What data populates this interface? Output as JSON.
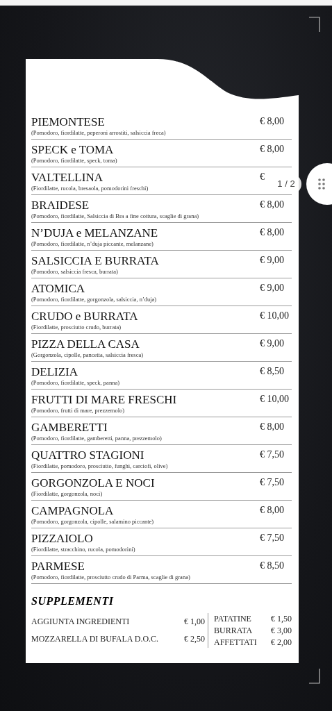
{
  "viewer": {
    "page_indicator": "1 / 2"
  },
  "menu": {
    "items": [
      {
        "name": "PIEMONTESE",
        "description": "(Pomodoro, fiordilatte, peperoni arrostiti, salsiccia freca)",
        "price": "€ 8,00"
      },
      {
        "name": "SPECK e TOMA",
        "description": "(Pomodoro, fiordilatte, speck, toma)",
        "price": "€ 8,00"
      },
      {
        "name": "VALTELLINA",
        "description": "(Fiordilatte, rucola, bresaola, pomodorini freschi)",
        "price": "€"
      },
      {
        "name": "BRAIDESE",
        "description": "(Pomodoro, fiordilatte, Salsiccia di Bra a fine cottura, scaglie di grana)",
        "price": "€ 8,00"
      },
      {
        "name": "N’DUJA e MELANZANE",
        "description": "(Pomodoro, fiordilatte, n’duja piccante, melanzane)",
        "price": "€ 8,00"
      },
      {
        "name": "SALSICCIA E BURRATA",
        "description": "(Pomodoro, salsiccia fresca, burrata)",
        "price": "€ 9,00"
      },
      {
        "name": "ATOMICA",
        "description": "(Pomodoro, fiordilatte, gorgonzola, salsiccia, n’duja)",
        "price": "€ 9,00"
      },
      {
        "name": "CRUDO e BURRATA",
        "description": "(Fiordilatte, prosciutto crudo, burrata)",
        "price": "€ 10,00"
      },
      {
        "name": "PIZZA DELLA CASA",
        "description": "(Gorgonzola, cipolle, pancetta, salsiccia fresca)",
        "price": "€ 9,00"
      },
      {
        "name": "DELIZIA",
        "description": "(Pomodoro, fiordilatte, speck, panna)",
        "price": "€ 8,50"
      },
      {
        "name": "FRUTTI DI MARE FRESCHI",
        "description": "(Pomodoro, frutti di mare, prezzemolo)",
        "price": "€ 10,00"
      },
      {
        "name": "GAMBERETTI",
        "description": "(Pomodoro, fiordilatte, gamberetti, panna, prezzemolo)",
        "price": "€ 8,00"
      },
      {
        "name": "QUATTRO STAGIONI",
        "description": "(Fiordilatte, pomodoro, prosciutto, funghi, carciofi, olive)",
        "price": "€ 7,50"
      },
      {
        "name": "GORGONZOLA E NOCI",
        "description": "(Fiordilatte, gorgonzola, noci)",
        "price": "€ 7,50"
      },
      {
        "name": "CAMPAGNOLA",
        "description": "(Pomodoro, gorgonzola, cipolle, salamino piccante)",
        "price": "€ 8,00"
      },
      {
        "name": "PIZZAIOLO",
        "description": "(Fiordilatte, stracchino, rucola, pomodorini)",
        "price": "€ 7,50"
      },
      {
        "name": "PARMESE",
        "description": "(Pomodoro, fiordilatte, prosciutto crudo di Parma, scaglie di grana)",
        "price": "€ 8,50"
      }
    ],
    "supplements": {
      "title": "SUPPLEMENTI",
      "left": [
        {
          "name": "AGGIUNTA INGREDIENTI",
          "price": "€ 1,00"
        },
        {
          "name": "MOZZARELLA DI BUFALA D.O.C.",
          "price": "€ 2,50"
        }
      ],
      "right": [
        {
          "name": "PATATINE",
          "price": "€ 1,50"
        },
        {
          "name": "BURRATA",
          "price": "€ 3,00"
        },
        {
          "name": "AFFETTATI",
          "price": "€ 2,00"
        }
      ]
    }
  }
}
